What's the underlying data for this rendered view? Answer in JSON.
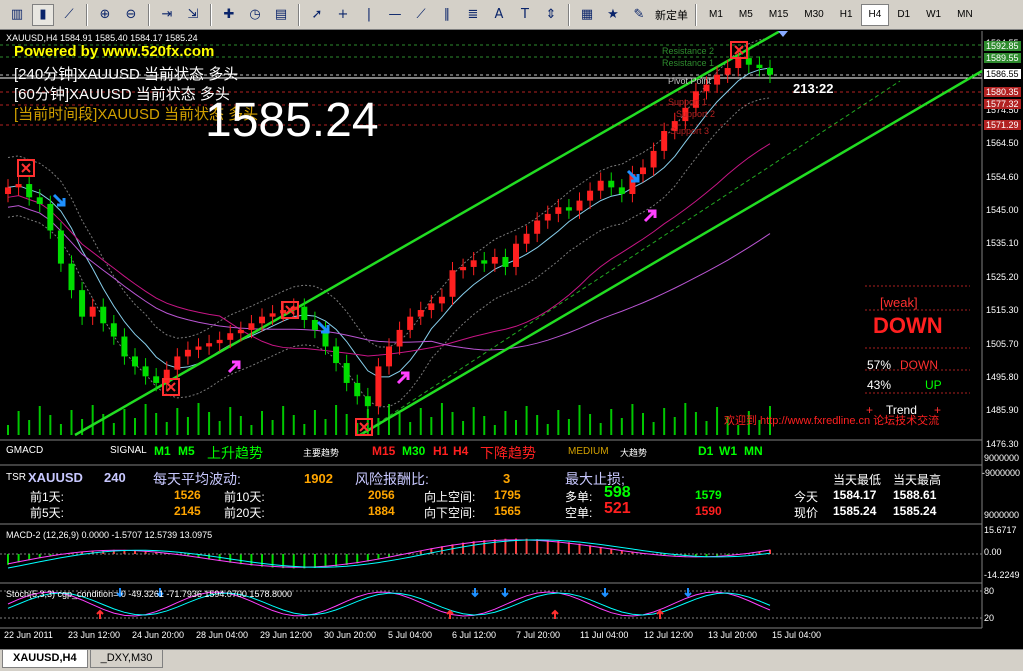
{
  "toolbar": {
    "new_order_label": "新定单",
    "timeframes": [
      "M1",
      "M5",
      "M15",
      "M30",
      "H1",
      "H4",
      "D1",
      "W1",
      "MN"
    ],
    "active_timeframe": "H4"
  },
  "chart": {
    "header": "XAUUSD,H4  1584.91 1585.40 1584.17 1585.24",
    "watermark": "Powered by www.520fx.com",
    "status_240": "[240分钟]XAUUSD 当前状态 多头",
    "status_60": "[60分钟]XAUUSD 当前状态 多头",
    "status_current": "[当前时间段]XAUUSD 当前状态 多头",
    "big_price": "1585.24",
    "countdown": "213:22",
    "level_labels": [
      "Resistance 2",
      "Resistance 1",
      "Pivot Point",
      "Support 1",
      "Support 2",
      "Support 3"
    ],
    "price_axis": [
      "1594.55",
      "1584.55",
      "1574.50",
      "1564.50",
      "1554.60",
      "1545.00",
      "1535.10",
      "1525.20",
      "1515.30",
      "1505.70",
      "1495.80",
      "1485.90",
      "1476.30"
    ],
    "price_flags": [
      "1592.85",
      "1589.55",
      "1586.55",
      "1580.35",
      "1577.32",
      "1571.29"
    ],
    "weak_label": "[weak]",
    "direction": "DOWN",
    "down_pct": "57%",
    "down_label": "DOWN",
    "up_pct": "43%",
    "up_label": "UP",
    "trend_label": "Trend",
    "forum_link": "欢迎到 http://www.fxredline.cn 论坛技术交流"
  },
  "gmacd": {
    "title": "GMACD",
    "signal_label": "SIGNAL",
    "m1": "M1",
    "m5": "M5",
    "up_trend": "上升趋势",
    "main_trend": "主要趋势",
    "m15": "M15",
    "m30": "M30",
    "h1": "H1",
    "h4": "H4",
    "down_trend": "下降趋势",
    "medium": "MEDIUM",
    "big_trend": "大趋势",
    "d1": "D1",
    "w1": "W1",
    "mn": "MN",
    "axis_value": "9000000"
  },
  "tsr": {
    "title": "TSR",
    "symbol": "XAUUSD",
    "period": "240",
    "avg_vol_label": "每天平均波动:",
    "avg_vol_value": "1902",
    "risk_label": "风险报酬比:",
    "risk_value": "3",
    "max_stop_label": "最大止损;",
    "day1_label": "前1天:",
    "day1_value": "1526",
    "day10_label": "前10天:",
    "day10_value": "2056",
    "day5_label": "前5天:",
    "day5_value": "2145",
    "day20_label": "前20天:",
    "day20_value": "1884",
    "up_space_label": "向上空间:",
    "up_space_value": "1795",
    "down_space_label": "向下空间:",
    "down_space_value": "1565",
    "long_label": "多单:",
    "long_value": "598",
    "long_value2": "1579",
    "short_label": "空单:",
    "short_value": "521",
    "short_value2": "1590",
    "today_low_label": "当天最低",
    "today_high_label": "当天最高",
    "today_label": "今天",
    "today_low": "1584.17",
    "today_high": "1588.61",
    "price_label": "现价",
    "price_low": "1585.24",
    "price_high": "1585.24",
    "axis_top": "-9000000",
    "axis_bottom": "9000000"
  },
  "macd": {
    "header": "MACD-2 (12,26,9) 0.0000 -1.5707 12.5739 13.0975",
    "axis": [
      "15.6717",
      "0.00",
      "-14.2249"
    ]
  },
  "stoch": {
    "header": "Stoch(5,3,3) cgp_condition= 0 -49.3261 -71.7936 1594.0700 1578.8000",
    "axis": [
      "80",
      "20"
    ]
  },
  "time_axis": [
    "22 Jun 2011",
    "23 Jun 12:00",
    "24 Jun 20:00",
    "28 Jun 04:00",
    "29 Jun 12:00",
    "30 Jun 20:00",
    "5 Jul 04:00",
    "6 Jul 12:00",
    "7 Jul 20:00",
    "11 Jul 04:00",
    "12 Jul 12:00",
    "13 Jul 20:00",
    "15 Jul 04:00"
  ],
  "tabs": [
    "XAUUSD,H4",
    "_DXY,M30"
  ],
  "chart_data": {
    "type": "candlestick",
    "closes": [
      1551,
      1552,
      1548,
      1546,
      1538,
      1528,
      1520,
      1512,
      1515,
      1510,
      1506,
      1500,
      1497,
      1494,
      1492,
      1496,
      1500,
      1502,
      1503,
      1504,
      1505,
      1507,
      1508,
      1510,
      1512,
      1513,
      1514,
      1515,
      1511,
      1508,
      1503,
      1498,
      1492,
      1488,
      1485,
      1497,
      1503,
      1508,
      1512,
      1514,
      1516,
      1518,
      1526,
      1527,
      1529,
      1528,
      1530,
      1527,
      1534,
      1537,
      1541,
      1543,
      1545,
      1544,
      1547,
      1550,
      1553,
      1551,
      1549,
      1555,
      1557,
      1562,
      1568,
      1571,
      1575,
      1580,
      1582,
      1585,
      1587,
      1590,
      1588,
      1587,
      1585
    ],
    "ylim": [
      1476.3,
      1594.55
    ]
  }
}
